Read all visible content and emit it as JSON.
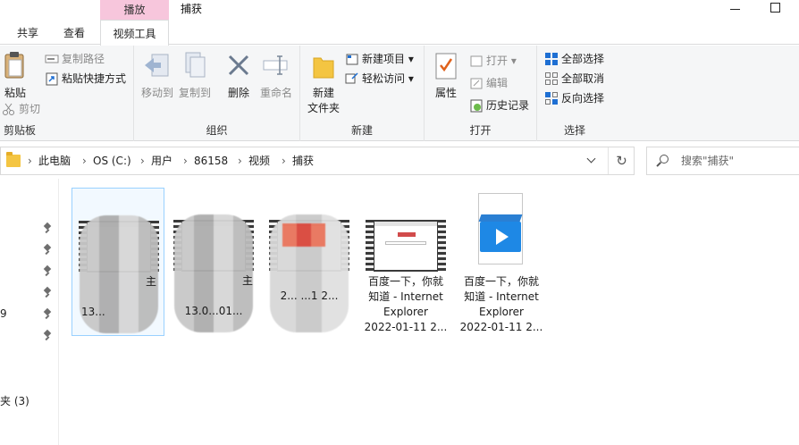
{
  "window": {
    "context_tab": "播放",
    "title": "捕获"
  },
  "tabs": {
    "share": "共享",
    "view": "查看",
    "video_tools": "视频工具"
  },
  "ribbon": {
    "clipboard": {
      "paste": "粘贴",
      "copy_path": "复制路径",
      "paste_shortcut": "粘贴快捷方式",
      "cut": "剪切",
      "label": "剪贴板"
    },
    "organize": {
      "move_to": "移动到",
      "copy_to": "复制到",
      "delete": "删除",
      "rename": "重命名",
      "label": "组织"
    },
    "new": {
      "new_folder": "新建\n文件夹",
      "new_folder_l1": "新建",
      "new_folder_l2": "文件夹",
      "new_item": "新建项目",
      "easy_access": "轻松访问",
      "label": "新建"
    },
    "open": {
      "properties": "属性",
      "open": "打开",
      "edit": "编辑",
      "history": "历史记录",
      "label": "打开"
    },
    "select": {
      "select_all": "全部选择",
      "select_none": "全部取消",
      "invert": "反向选择",
      "label": "选择"
    }
  },
  "address": {
    "crumbs": [
      "此电脑",
      "OS (C:)",
      "用户",
      "86158",
      "视频",
      "捕获"
    ]
  },
  "search": {
    "placeholder": "搜索\"捕获\""
  },
  "nav": {
    "partial_num": "9",
    "partial_folder": "夹 (3)"
  },
  "files": [
    {
      "name_l1": "",
      "name_l2": "主",
      "date": "13..."
    },
    {
      "name_l1": "",
      "name_l2": "主",
      "date": "13.0...01..."
    },
    {
      "name_l1": "",
      "name_l2": "",
      "date": "2... ...1 2..."
    },
    {
      "name_l1": "百度一下，你就",
      "name_l2": "知道 - Internet",
      "name_l3": "Explorer",
      "date": "2022-01-11 2..."
    },
    {
      "name_l1": "百度一下，你就",
      "name_l2": "知道 - Internet",
      "name_l3": "Explorer",
      "date": "2022-01-11 2..."
    }
  ],
  "colors": {
    "context_tab": "#f7c6dc",
    "ribbon_bg": "#f5f6f7",
    "selection_border": "#99d1ff",
    "video_blue": "#1e88e5"
  }
}
